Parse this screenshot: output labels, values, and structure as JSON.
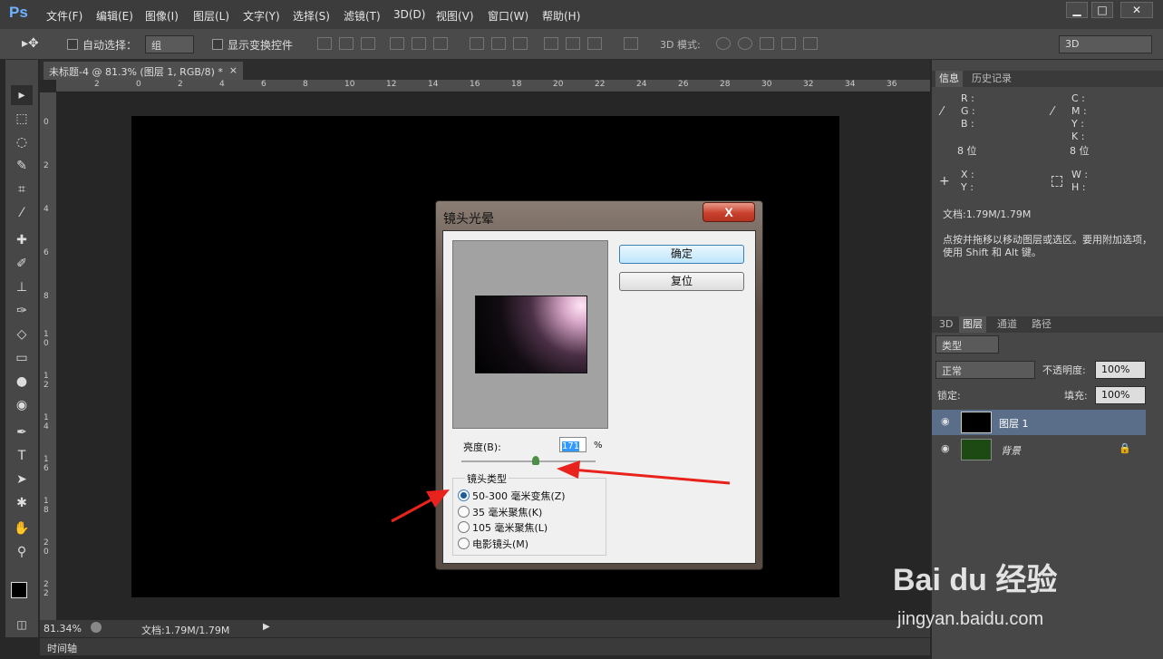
{
  "app": {
    "logo": "Ps",
    "menus": [
      "文件(F)",
      "编辑(E)",
      "图像(I)",
      "图层(L)",
      "文字(Y)",
      "选择(S)",
      "滤镜(T)",
      "3D(D)",
      "视图(V)",
      "窗口(W)",
      "帮助(H)"
    ],
    "window_controls": [
      "▁",
      "□",
      "✕"
    ]
  },
  "options": {
    "auto_select_label": "自动选择：",
    "auto_select_value": "组",
    "show_transform_label": "显示变换控件",
    "mode3d_label": "3D 模式:",
    "workspace_value": "3D"
  },
  "document": {
    "tab_title": "未标题-4 @ 81.3% (图层 1, RGB/8) *",
    "close": "×",
    "ruler_h": [
      "2",
      "0",
      "2",
      "4",
      "6",
      "8",
      "10",
      "12",
      "14",
      "16",
      "18",
      "20",
      "22",
      "24",
      "26",
      "28",
      "30",
      "32",
      "34",
      "36"
    ],
    "ruler_v": [
      "0",
      "2",
      "4",
      "6",
      "8",
      "1\n0",
      "1\n2",
      "1\n4",
      "1\n6",
      "1\n8",
      "2\n0",
      "2\n2"
    ]
  },
  "status": {
    "zoom": "81.34%",
    "doc": "文档:1.79M/1.79M",
    "timeline": "时间轴"
  },
  "info_panel": {
    "tabs": [
      "信息",
      "历史记录"
    ],
    "rgb": [
      "R :",
      "G :",
      "B :"
    ],
    "cmyk": [
      "C :",
      "M :",
      "Y :",
      "K :"
    ],
    "bit_left": "8 位",
    "bit_right": "8 位",
    "xy": [
      "X :",
      "Y :"
    ],
    "wh": [
      "W :",
      "H :"
    ],
    "doc": "文档:1.79M/1.79M",
    "hint": "点按并拖移以移动图层或选区。要用附加选项，使用 Shift 和 Alt 键。"
  },
  "layers_panel": {
    "tabs": [
      "3D",
      "图层",
      "通道",
      "路径"
    ],
    "filter": "类型",
    "blend": "正常",
    "opacity_label": "不透明度:",
    "opacity": "100%",
    "lock_label": "锁定:",
    "fill_label": "填充:",
    "fill": "100%",
    "layers": [
      {
        "name": "图层 1"
      },
      {
        "name": "背景"
      }
    ]
  },
  "dialog": {
    "title": "镜头光晕",
    "close": "X",
    "ok": "确定",
    "reset": "复位",
    "brightness_label": "亮度(B):",
    "brightness_value": "171",
    "percent": "%",
    "lens_group": "镜头类型",
    "lens_types": [
      "50-300 毫米变焦(Z)",
      "35 毫米聚焦(K)",
      "105 毫米聚焦(L)",
      "电影镜头(M)"
    ],
    "selected_lens": 0
  },
  "watermark": {
    "brand": "Bai du 经验",
    "url": "jingyan.baidu.com"
  },
  "colors": {
    "accent": "#4a8fd6",
    "arrow": "#e8231d",
    "selected_layer": "#5a6e8a"
  }
}
